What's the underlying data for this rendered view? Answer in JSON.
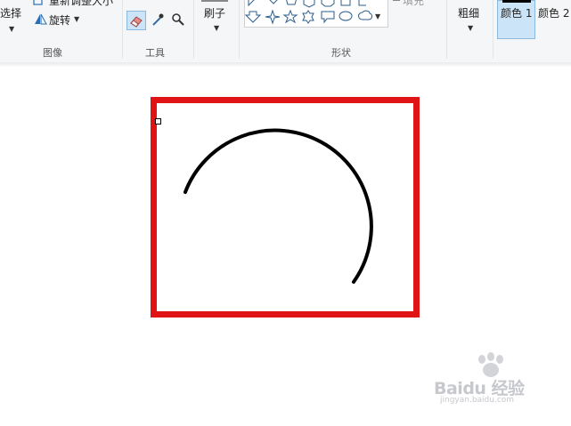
{
  "ribbon": {
    "image_group": {
      "select_label": "选择",
      "resize_label": "重新调整大小",
      "rotate_label": "旋转",
      "group_label": "图像"
    },
    "tools_group": {
      "group_label": "工具"
    },
    "brushes": {
      "label": "刷子"
    },
    "shapes_group": {
      "fill_label": "填充",
      "group_label": "形状"
    },
    "size": {
      "label": "粗细"
    },
    "colors": {
      "color1_label": "颜色 1",
      "color2_label": "颜色 2"
    }
  },
  "canvas": {
    "rectangle_color": "#e01414",
    "arc_color": "#000000",
    "background": "#ffffff"
  },
  "watermark": {
    "main": "Baidu 经验",
    "sub": "jingyan.baidu.com"
  }
}
